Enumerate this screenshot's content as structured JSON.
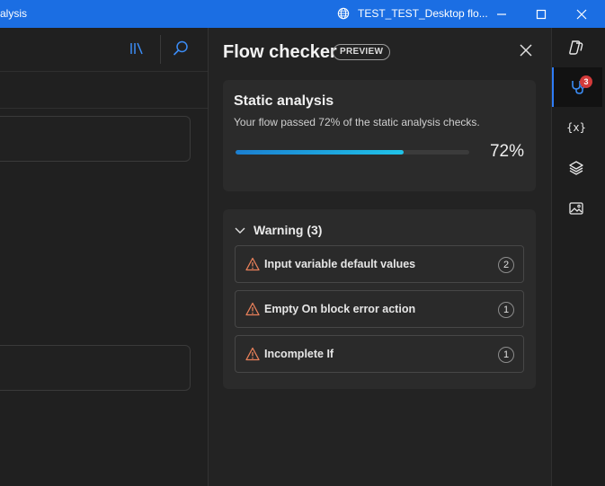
{
  "titlebar": {
    "left_text": "alysis",
    "doc_title": "TEST_TEST_Desktop flo...",
    "minimize_icon": "minimize-icon",
    "maximize_icon": "maximize-icon",
    "close_icon": "close-icon"
  },
  "left_toolbar": {
    "library_icon": "library-icon",
    "search_icon": "search-icon"
  },
  "panel": {
    "title": "Flow checker",
    "badge": "PREVIEW",
    "close_icon": "close-icon"
  },
  "static_analysis": {
    "title": "Static analysis",
    "subtitle": "Your flow passed 72% of the static analysis checks.",
    "progress_percent": 72,
    "progress_label": "72%"
  },
  "warnings": {
    "header": "Warning (3)",
    "items": [
      {
        "label": "Input variable default values",
        "count": "2"
      },
      {
        "label": "Empty On block error action",
        "count": "1"
      },
      {
        "label": "Incomplete If",
        "count": "1"
      }
    ]
  },
  "rail": {
    "items": [
      {
        "icon": "copilot-icon"
      },
      {
        "icon": "flow-checker-icon",
        "badge": "3",
        "active": true
      },
      {
        "icon": "variables-icon",
        "text": "{x}"
      },
      {
        "icon": "layers-icon"
      },
      {
        "icon": "images-icon"
      }
    ]
  },
  "colors": {
    "accent": "#1b6ee3",
    "progress_start": "#1b7fd1",
    "progress_end": "#20c3e8",
    "warning": "#e8805a",
    "badge_red": "#d23a3a"
  }
}
